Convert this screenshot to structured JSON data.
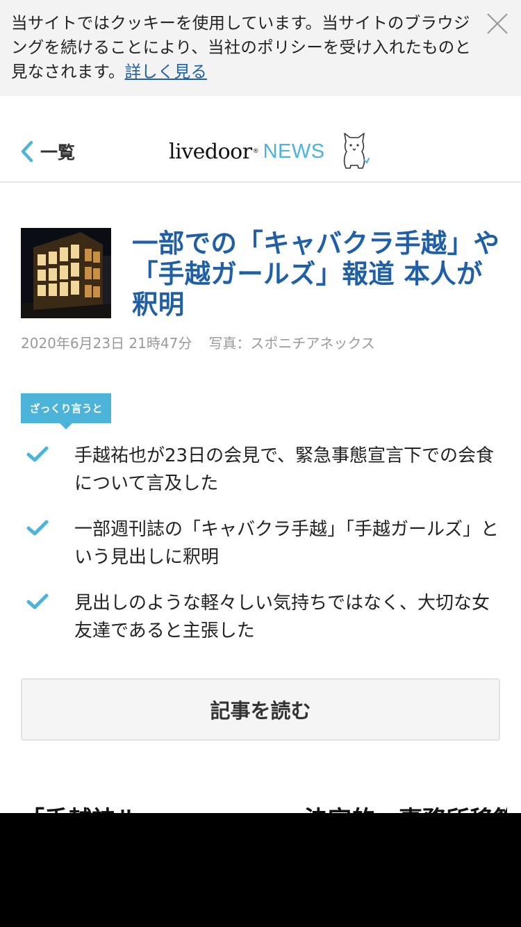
{
  "cookie_banner": {
    "text": "当サイトではクッキーを使用しています。当サイトのブラウジングを続けることにより、当社のポリシーを受け入れたものと見なされます。",
    "link_label": "詳しく見る"
  },
  "header": {
    "back_label": "一覧",
    "logo_main": "livedoor",
    "logo_news": "NEWS"
  },
  "article": {
    "title": "一部での「キャバクラ手越」や「手越ガールズ」報道 本人が釈明",
    "date": "2020年6月23日 21時47分",
    "photo_credit": "写真：スポニチアネックス"
  },
  "summary": {
    "tag": "ざっくり言うと",
    "items": [
      "手越祐也が23日の会見で、緊急事態宣言下での会食について言及した",
      "一部週刊誌の「キャバクラ手越」「手越ガールズ」という見出しに釈明",
      "見出しのような軽々しい気持ちではなく、大切な女友達であると主張した"
    ]
  },
  "read_button_label": "記事を読む",
  "next_heading": "「手越神ル――――――」決定的…事務所移籍へ",
  "colors": {
    "accent": "#4bb4d8",
    "title": "#1f5fa8",
    "link": "#1f5fa8"
  }
}
